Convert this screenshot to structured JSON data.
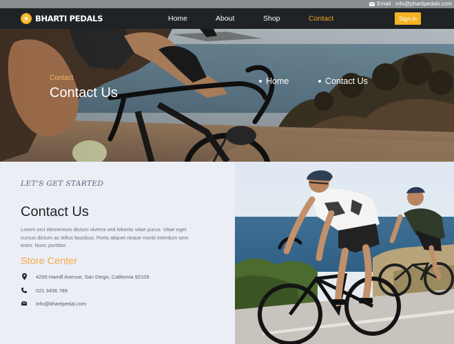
{
  "topbar": {
    "email_text": "Email : info@phartipedals.com",
    "icon": "envelope-icon"
  },
  "navbar": {
    "brand": "BHARTI PEDALS",
    "logo_icon": "sun-icon",
    "links": [
      {
        "label": "Home"
      },
      {
        "label": "About"
      },
      {
        "label": "Shop"
      },
      {
        "label": "Contact",
        "active": true
      }
    ],
    "signin_label": "Sign in"
  },
  "hero": {
    "eyebrow": "Contact",
    "title": "Contact Us",
    "breadcrumb": [
      "Home",
      "Contact Us"
    ]
  },
  "section": {
    "kicker": "LET'S GET STARTED",
    "title": "Contact Us",
    "paragraph": "Lorem orci elementum dictum viverra sed lobortis vitae purus. Vitae eget cursus dictum ac tellus faucibus. Porta aliquet neque morbi interdum sem enim. Nunc porttitor.",
    "store_title": "Store Center",
    "address": "4200 Hamill Avenue, San Diego, California 92109",
    "phone": "021 3456 789",
    "email": "info@bhartipedal.com"
  },
  "colors": {
    "accent": "#f5a623",
    "nav_bg": "#1f2326",
    "section_bg": "#eceef6"
  }
}
